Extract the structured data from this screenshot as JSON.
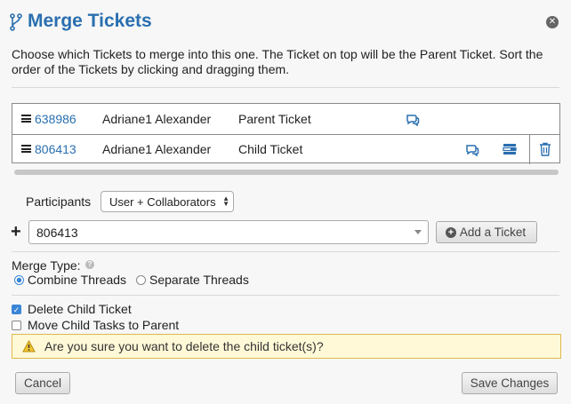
{
  "header": {
    "title": "Merge Tickets",
    "close_icon": "close-icon"
  },
  "description": "Choose which Tickets to merge into this one. The Ticket on top will be the Parent Ticket. Sort the order of the Tickets by clicking and dragging them.",
  "tickets": [
    {
      "number": "638986",
      "name": "Adriane1 Alexander",
      "role": "Parent Ticket",
      "icons": [
        "drag-handle-icon",
        "thread-icon"
      ]
    },
    {
      "number": "806413",
      "name": "Adriane1 Alexander",
      "role": "Child Ticket",
      "icons": [
        "drag-handle-icon",
        "thread-icon",
        "tasks-icon",
        "trash-icon"
      ]
    }
  ],
  "participants": {
    "label": "Participants",
    "selected": "User + Collaborators"
  },
  "add_ticket": {
    "plus_label": "+",
    "value": "806413",
    "button_label": "Add a Ticket"
  },
  "merge_type": {
    "label": "Merge Type:",
    "options": [
      "Combine Threads",
      "Separate Threads"
    ],
    "selected": "Combine Threads"
  },
  "options": {
    "delete_child": {
      "label": "Delete Child Ticket",
      "checked": true
    },
    "move_tasks": {
      "label": "Move Child Tasks to Parent",
      "checked": false
    }
  },
  "warning": "Are you sure you want to delete the child ticket(s)?",
  "footer": {
    "cancel_label": "Cancel",
    "save_label": "Save Changes"
  },
  "colors": {
    "accent": "#2a6fb0",
    "warning_bg": "#fff9d7",
    "warning_border": "#e0b84a",
    "radio_checkbox": "#3a86d6"
  }
}
